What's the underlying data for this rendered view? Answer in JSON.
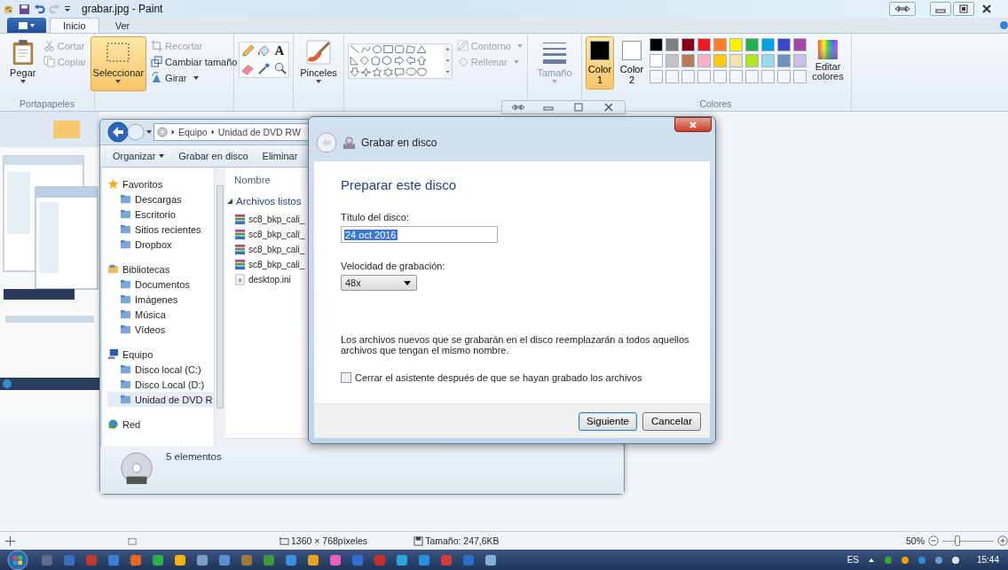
{
  "window": {
    "title": "grabar.jpg - Paint"
  },
  "ribbon_tabs": [
    {
      "label": "Inicio",
      "selected": true
    },
    {
      "label": "Ver",
      "selected": false
    }
  ],
  "clipboard": {
    "paste": "Pegar",
    "cut": {
      "label": "Cortar",
      "disabled": true
    },
    "copy": {
      "label": "Copiar",
      "disabled": true
    },
    "group_label": "Portapapeles"
  },
  "image": {
    "select": {
      "label": "Seleccionar",
      "selected": true
    },
    "crop": {
      "label": "Recortar",
      "disabled": true
    },
    "resize": {
      "label": "Cambiar tamaño",
      "disabled": false
    },
    "rotate": {
      "label": "Girar",
      "disabled": false
    }
  },
  "tools": {
    "text_tool": "A"
  },
  "brushes": {
    "label": "Pinceles"
  },
  "shapes": {
    "outline": {
      "label": "Contorno",
      "disabled": true
    },
    "fill": {
      "label": "Rellenar",
      "disabled": true
    }
  },
  "size": {
    "label": "Tamaño",
    "disabled": true
  },
  "colors": {
    "current": [
      {
        "label": "Color",
        "number": "1",
        "color": "#000000",
        "selected": true
      },
      {
        "label": "Color",
        "number": "2",
        "color": "#ffffff",
        "selected": false
      }
    ],
    "palette": [
      {
        "color": "#000000"
      },
      {
        "color": "#7f7f7f"
      },
      {
        "color": "#880015"
      },
      {
        "color": "#ed1c24"
      },
      {
        "color": "#ff7f27"
      },
      {
        "color": "#fff200"
      },
      {
        "color": "#22b14c"
      },
      {
        "color": "#00a2e8"
      },
      {
        "color": "#3f48cc"
      },
      {
        "color": "#a349a4"
      },
      {
        "color": "#ffffff"
      },
      {
        "color": "#c3c3c3"
      },
      {
        "color": "#b97a57"
      },
      {
        "color": "#ffaec9"
      },
      {
        "color": "#ffc90e"
      },
      {
        "color": "#efe4b0"
      },
      {
        "color": "#b5e61d"
      },
      {
        "color": "#99d9ea"
      },
      {
        "color": "#7092be"
      },
      {
        "color": "#c8bfe7"
      },
      {
        "kind": "empty"
      },
      {
        "kind": "empty"
      },
      {
        "kind": "empty"
      },
      {
        "kind": "empty"
      },
      {
        "kind": "empty"
      },
      {
        "kind": "empty"
      },
      {
        "kind": "empty"
      },
      {
        "kind": "empty"
      },
      {
        "kind": "empty"
      },
      {
        "kind": "empty"
      }
    ],
    "group_label": "Colores",
    "edit": "Editar colores"
  },
  "explorer": {
    "breadcrumb": [
      "Equipo",
      "Unidad de DVD RW"
    ],
    "toolbar": [
      "Organizar",
      "Grabar en disco",
      "Eliminar"
    ],
    "navigation": [
      {
        "label": "Favoritos",
        "kind": "favorites",
        "children": [
          {
            "label": "Descargas",
            "selected": false
          },
          {
            "label": "Escritorio",
            "selected": false
          },
          {
            "label": "Sitios recientes",
            "selected": false
          },
          {
            "label": "Dropbox",
            "selected": false
          }
        ]
      },
      {
        "label": "Bibliotecas",
        "kind": "libraries",
        "children": [
          {
            "label": "Documentos",
            "selected": false
          },
          {
            "label": "Imágenes",
            "selected": false
          },
          {
            "label": "Música",
            "selected": false
          },
          {
            "label": "Vídeos",
            "selected": false
          }
        ]
      },
      {
        "label": "Equipo",
        "kind": "computer",
        "children": [
          {
            "label": "Disco local (C:)",
            "selected": false
          },
          {
            "label": "Disco Local (D:)",
            "selected": false
          },
          {
            "label": "Unidad de DVD R",
            "selected": true
          }
        ]
      },
      {
        "label": "Red",
        "kind": "network"
      }
    ],
    "column": "Nombre",
    "group": "Archivos listos",
    "files": [
      {
        "name": "sc8_bkp_cali_",
        "kind": "archive"
      },
      {
        "name": "sc8_bkp_cali_",
        "kind": "archive"
      },
      {
        "name": "sc8_bkp_cali_",
        "kind": "archive"
      },
      {
        "name": "sc8_bkp_cali_",
        "kind": "archive"
      },
      {
        "name": "desktop.ini",
        "kind": "settings"
      }
    ],
    "details": "5 elementos"
  },
  "dialog": {
    "title": "Grabar en disco",
    "heading": "Preparar este disco",
    "title_label": "Título del disco:",
    "title_value": "24 oct 2016",
    "speed_label": "Velocidad de grabación:",
    "speed_value": "48x",
    "note": "Los archivos nuevos que se grabarán en el disco reemplazarán a todos aquellos archivos que tengan el mismo nombre.",
    "close_checkbox": {
      "label": "Cerrar el asistente después de que se hayan grabado los archivos",
      "checked": false
    },
    "buttons": [
      {
        "label": "Siguiente",
        "default": true
      },
      {
        "label": "Cancelar",
        "default": false
      }
    ]
  },
  "status_bar": {
    "dimensions": "1360 × 768píxeles",
    "file_size": "Tamaño: 247,6KB",
    "zoom": "50%",
    "zoom_slider": {
      "level": 0.3
    }
  },
  "taskbar": {
    "language": "ES",
    "time": "15:44"
  }
}
